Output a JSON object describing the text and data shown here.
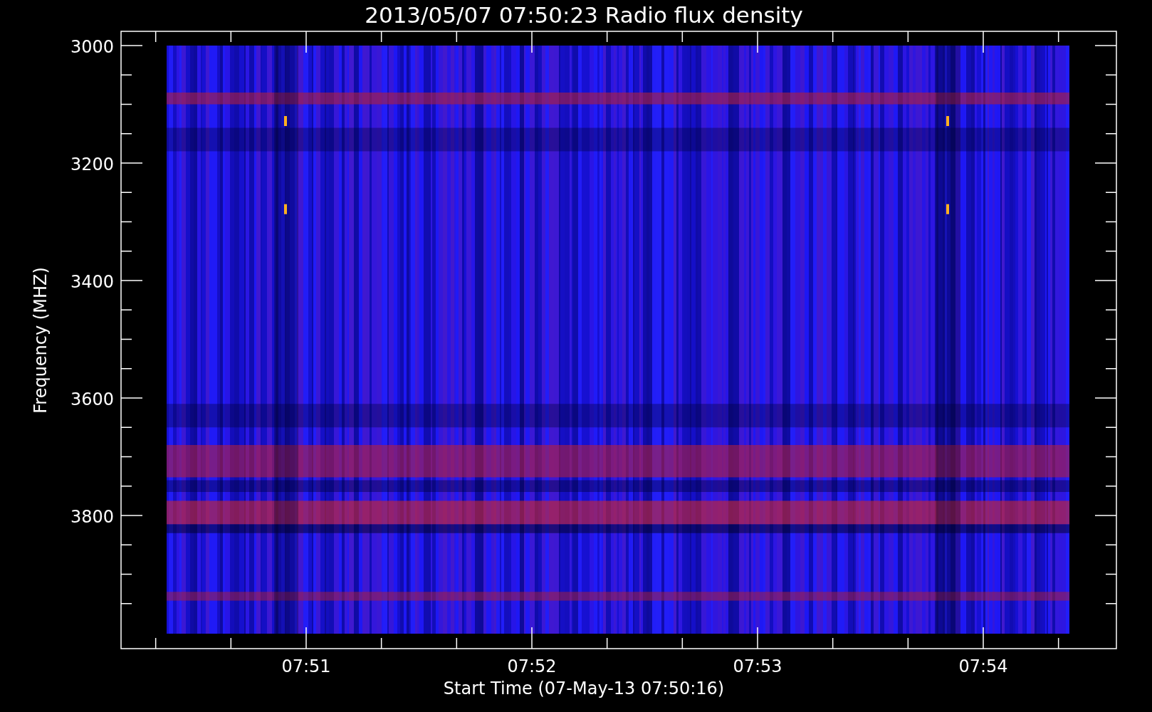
{
  "plot": {
    "title": "2013/05/07 07:50:23 Radio flux density",
    "ylabel": "Frequency (MHZ)",
    "xlabel": "Start Time (07-May-13 07:50:16)",
    "yticks": [
      "3000",
      "3200",
      "3400",
      "3600",
      "3800"
    ],
    "xticks": [
      "07:51",
      "07:52",
      "07:53",
      "07:54"
    ]
  }
}
